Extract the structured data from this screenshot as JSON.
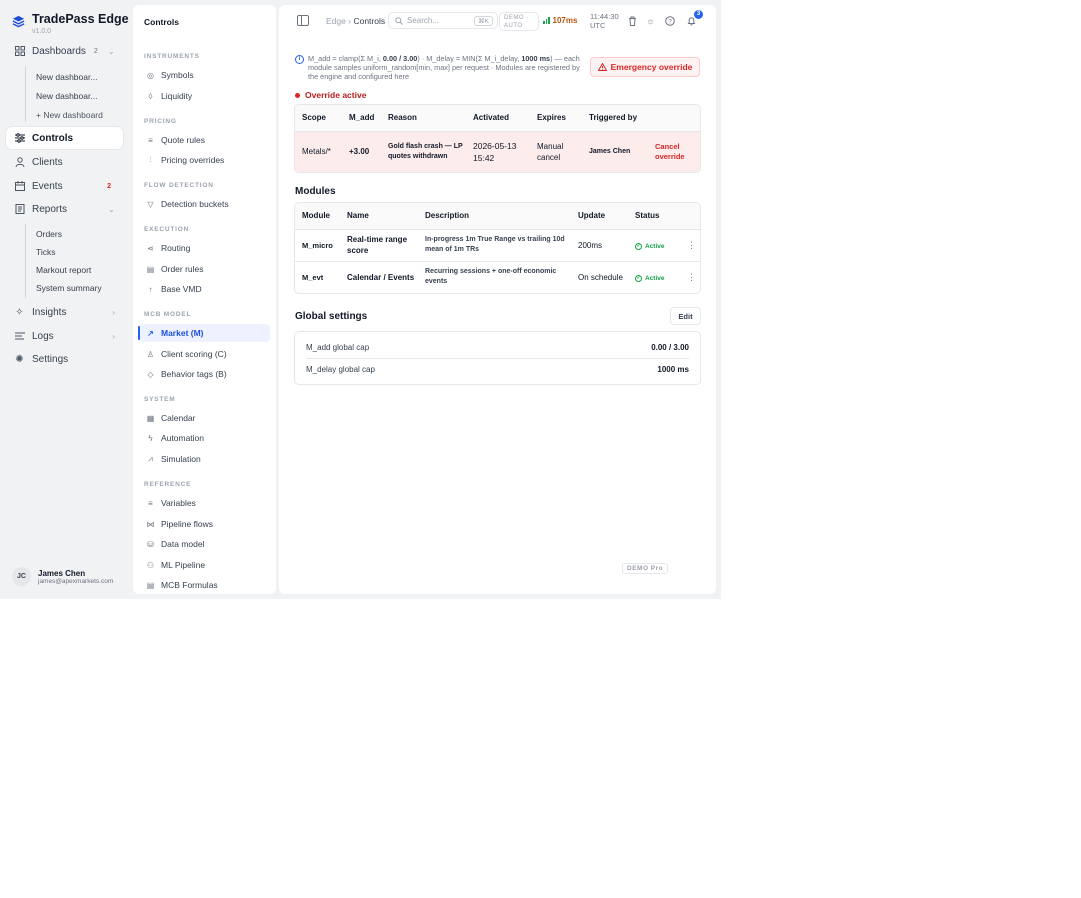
{
  "app": {
    "name": "TradePass Edge",
    "version": "v1.0.0"
  },
  "nav": {
    "dashboards": {
      "label": "Dashboards",
      "count": "2"
    },
    "dashboard_items": [
      "New dashboar...",
      "New dashboar..."
    ],
    "new_dashboard": "+ New dashboard",
    "controls": "Controls",
    "clients": "Clients",
    "events": {
      "label": "Events",
      "count": "2"
    },
    "reports": "Reports",
    "report_items": [
      "Orders",
      "Ticks",
      "Markout report",
      "System summary"
    ],
    "insights": "Insights",
    "logs": "Logs",
    "settings": "Settings"
  },
  "user": {
    "initials": "JC",
    "name": "James Chen",
    "email": "james@apexmarkets.com"
  },
  "secondary": {
    "title": "Controls",
    "sections": [
      {
        "heading": "INSTRUMENTS",
        "items": [
          "Symbols",
          "Liquidity"
        ]
      },
      {
        "heading": "PRICING",
        "items": [
          "Quote rules",
          "Pricing overrides"
        ]
      },
      {
        "heading": "FLOW DETECTION",
        "items": [
          "Detection buckets"
        ]
      },
      {
        "heading": "EXECUTION",
        "items": [
          "Routing",
          "Order rules",
          "Base VMD"
        ]
      },
      {
        "heading": "MCB MODEL",
        "items": [
          "Market (M)",
          "Client scoring (C)",
          "Behavior tags (B)"
        ]
      },
      {
        "heading": "SYSTEM",
        "items": [
          "Calendar",
          "Automation",
          "Simulation"
        ]
      },
      {
        "heading": "REFERENCE",
        "items": [
          "Variables",
          "Pipeline flows",
          "Data model",
          "ML Pipeline",
          "MCB Formulas"
        ]
      }
    ]
  },
  "topbar": {
    "crumb_root": "Edge",
    "crumb_sep": "›",
    "crumb_current": "Controls",
    "search_placeholder": "Search...",
    "search_shortcut": "⌘K",
    "mode_line1": "DEMO ·",
    "mode_line2": "AUTO",
    "latency": "107ms",
    "time": "11:44:30",
    "timezone": "UTC",
    "notifications": "3"
  },
  "info": {
    "p1": "M_add = clamp(Σ M_i, ",
    "cap": "0.00 / 3.00",
    "p2": ") · M_delay = MIN(Σ M_i_delay, ",
    "delay": "1000 ms",
    "p3": ") — each module samples uniform_random[min, max] per request · Modules are registered by the engine and configured here"
  },
  "emergency_button": "Emergency override",
  "override": {
    "status": "Override active",
    "columns": [
      "Scope",
      "M_add",
      "Reason",
      "Activated",
      "Expires",
      "Triggered by",
      ""
    ],
    "row": {
      "scope": "Metals/*",
      "m_add": "+3.00",
      "reason": "Gold flash crash — LP quotes withdrawn",
      "activated": "2026-05-13 15:42",
      "expires": "Manual cancel",
      "triggered_by": "James Chen",
      "action": "Cancel override"
    }
  },
  "modules": {
    "title": "Modules",
    "columns": [
      "Module",
      "Name",
      "Description",
      "Update",
      "Status",
      ""
    ],
    "rows": [
      {
        "module": "M_micro",
        "name": "Real-time range score",
        "description": "In-progress 1m True Range vs trailing 10d mean of 1m TRs",
        "update": "200ms",
        "status": "Active"
      },
      {
        "module": "M_evt",
        "name": "Calendar / Events",
        "description": "Recurring sessions + one-off economic events",
        "update": "On schedule",
        "status": "Active"
      }
    ]
  },
  "global_settings": {
    "title": "Global settings",
    "edit": "Edit",
    "rows": [
      {
        "label": "M_add global cap",
        "value": "0.00 / 3.00"
      },
      {
        "label": "M_delay global cap",
        "value": "1000 ms"
      }
    ]
  },
  "footer_tag": "DEMO Pro",
  "colors": {
    "accent": "#2563eb",
    "danger": "#dc2626",
    "success": "#16a34a"
  }
}
